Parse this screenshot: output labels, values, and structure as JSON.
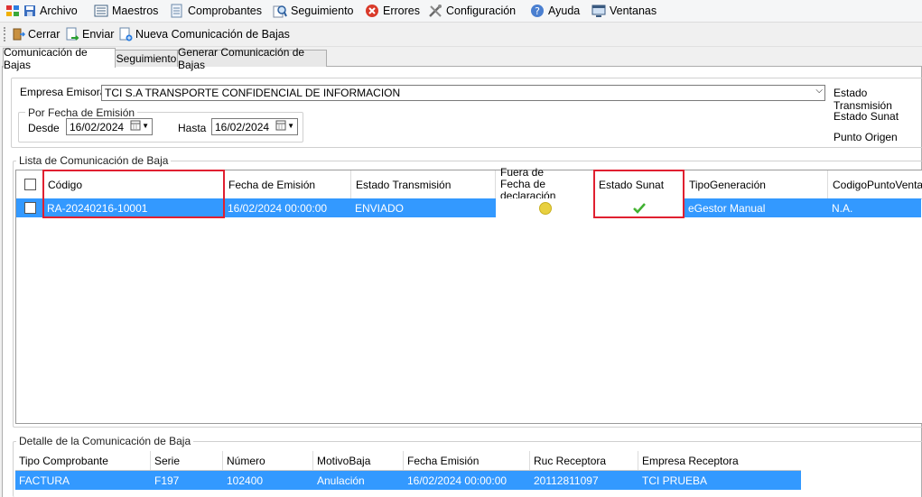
{
  "menu": [
    {
      "label": "Archivo",
      "icon": "archivo-icon"
    },
    {
      "label": "Maestros",
      "icon": "maestros-icon"
    },
    {
      "label": "Comprobantes",
      "icon": "comprobantes-icon"
    },
    {
      "label": "Seguimiento",
      "icon": "seguimiento-icon"
    },
    {
      "label": "Errores",
      "icon": "errores-icon"
    },
    {
      "label": "Configuración",
      "icon": "configuracion-icon"
    },
    {
      "label": "Ayuda",
      "icon": "ayuda-icon"
    },
    {
      "label": "Ventanas",
      "icon": "ventanas-icon"
    }
  ],
  "toolbar": {
    "close_label": "Cerrar",
    "send_label": "Enviar",
    "new_label": "Nueva Comunicación de Bajas"
  },
  "tabs": [
    {
      "label": "Comunicación de Bajas",
      "active": true
    },
    {
      "label": "Seguimiento",
      "active": false
    },
    {
      "label": "Generar Comunicación de Bajas",
      "active": false
    }
  ],
  "filters": {
    "empresa_label": "Empresa Emisora",
    "empresa_value": "TCI S.A TRANSPORTE CONFIDENCIAL DE INFORMACION",
    "fecha_group_title": "Por Fecha de Emisión",
    "desde_label": "Desde",
    "desde_value": "16/02/2024",
    "hasta_label": "Hasta",
    "hasta_value": "16/02/2024",
    "estado_transmision_label": "Estado Transmisión",
    "estado_sunat_label": "Estado Sunat",
    "punto_origen_label": "Punto Origen"
  },
  "lista": {
    "title": "Lista de Comunicación de Baja",
    "columns": [
      "Código",
      "Fecha de Emisión",
      "Estado Transmisión",
      "Fuera de Fecha de declaración",
      "Estado Sunat",
      "TipoGeneración",
      "CodigoPuntoVenta"
    ],
    "rows": [
      {
        "codigo": "RA-20240216-10001",
        "fecha": "16/02/2024 00:00:00",
        "estado_transmision": "ENVIADO",
        "fuera_fecha": "yellow-dot-icon",
        "estado_sunat": "check-icon",
        "tipo_generacion": "eGestor Manual",
        "codigo_punto_venta": "N.A."
      }
    ]
  },
  "detalle": {
    "title": "Detalle de la Comunicación de Baja",
    "columns": [
      "Tipo Comprobante",
      "Serie",
      "Número",
      "MotivoBaja",
      "Fecha Emisión",
      "Ruc Receptora",
      "Empresa Receptora"
    ],
    "rows": [
      {
        "tipo": "FACTURA",
        "serie": "F197",
        "numero": "102400",
        "motivo": "Anulación",
        "fecha": "16/02/2024 00:00:00",
        "ruc": "20112811097",
        "empresa": "TCI PRUEBA"
      }
    ]
  },
  "colors": {
    "selection": "#3399ff",
    "highlight_box": "#e02030",
    "ok_check": "#3fb030",
    "warning_dot": "#e8d040"
  }
}
